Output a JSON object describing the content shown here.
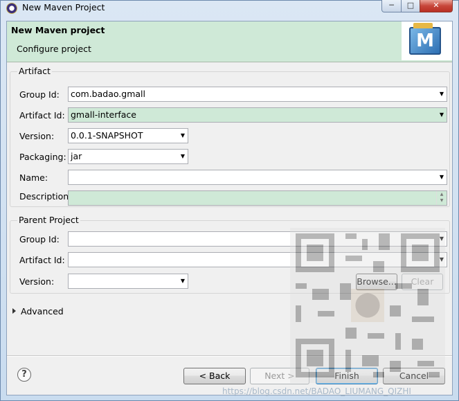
{
  "window": {
    "title": "New Maven Project",
    "controls": {
      "minimize": "─",
      "maximize": "□",
      "close": "✕"
    }
  },
  "banner": {
    "title": "New Maven project",
    "subtitle": "Configure project",
    "logo_letter": "M"
  },
  "artifact": {
    "label": "Artifact",
    "group_id": {
      "label": "Group Id:",
      "value": "com.badao.gmall"
    },
    "artifact_id": {
      "label": "Artifact Id:",
      "value": "gmall-interface"
    },
    "version": {
      "label": "Version:",
      "value": "0.0.1-SNAPSHOT"
    },
    "packaging": {
      "label": "Packaging:",
      "value": "jar"
    },
    "name": {
      "label": "Name:",
      "value": ""
    },
    "description": {
      "label": "Description:",
      "value": ""
    }
  },
  "parent": {
    "label": "Parent Project",
    "group_id": {
      "label": "Group Id:",
      "value": ""
    },
    "artifact_id": {
      "label": "Artifact Id:",
      "value": ""
    },
    "version": {
      "label": "Version:",
      "value": ""
    },
    "browse_button": "Browse...",
    "clear_button": "Clear"
  },
  "advanced": {
    "label": "Advanced"
  },
  "footer": {
    "help_icon": "?",
    "back_button": "< Back",
    "next_button": "Next >",
    "finish_button": "Finish",
    "cancel_button": "Cancel"
  },
  "watermark": "https://blog.csdn.net/BADAO_LIUMANG_QIZHI",
  "colors": {
    "banner_bg": "#cfe9d7",
    "highlight_field": "#cfe9d7",
    "dialog_bg": "#f0f0f0",
    "frame": "#c9dcef"
  }
}
